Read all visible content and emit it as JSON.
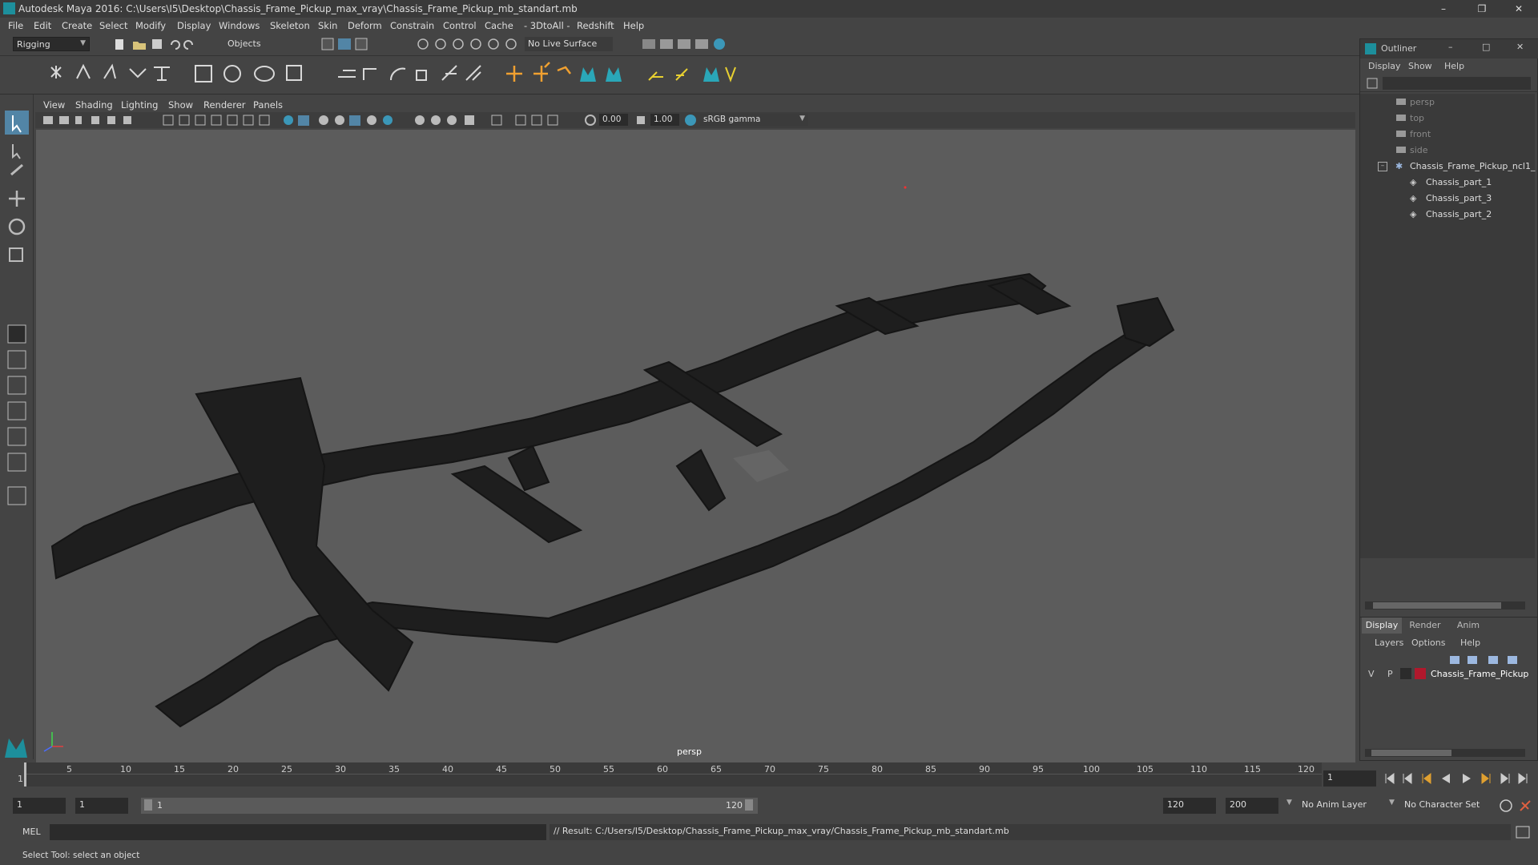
{
  "window": {
    "title": "Autodesk Maya 2016: C:\\Users\\I5\\Desktop\\Chassis_Frame_Pickup_max_vray\\Chassis_Frame_Pickup_mb_standart.mb"
  },
  "menubar": [
    "File",
    "Edit",
    "Create",
    "Select",
    "Modify",
    "Display",
    "Windows",
    "Skeleton",
    "Skin",
    "Deform",
    "Constrain",
    "Control",
    "Cache",
    "- 3DtoAll -",
    "Redshift",
    "Help"
  ],
  "shelf": {
    "mode": "Rigging",
    "object_mode": "Objects",
    "live_surface": "No Live Surface"
  },
  "viewport": {
    "menu": [
      "View",
      "Shading",
      "Lighting",
      "Show",
      "Renderer",
      "Panels"
    ],
    "near_value": "0.00",
    "far_value": "1.00",
    "color_space": "sRGB gamma",
    "camera_label": "persp"
  },
  "outliner": {
    "title": "Outliner",
    "menu": [
      "Display",
      "Show",
      "Help"
    ],
    "items": [
      {
        "label": "persp",
        "type": "camera",
        "indent": 0
      },
      {
        "label": "top",
        "type": "camera",
        "indent": 0
      },
      {
        "label": "front",
        "type": "camera",
        "indent": 0
      },
      {
        "label": "side",
        "type": "camera",
        "indent": 0
      },
      {
        "label": "Chassis_Frame_Pickup_ncl1_",
        "type": "group",
        "indent": 0
      },
      {
        "label": "Chassis_part_1",
        "type": "mesh",
        "indent": 1
      },
      {
        "label": "Chassis_part_3",
        "type": "mesh",
        "indent": 1
      },
      {
        "label": "Chassis_part_2",
        "type": "mesh",
        "indent": 1
      }
    ]
  },
  "layers": {
    "tabs": [
      "Display",
      "Render",
      "Anim"
    ],
    "menu": [
      "Layers",
      "Options",
      "Help"
    ],
    "layer": {
      "v": "V",
      "p": "P",
      "name": "Chassis_Frame_Pickup",
      "color": "#b0182c"
    }
  },
  "timeline": {
    "ticks": [
      "1",
      "5",
      "10",
      "15",
      "20",
      "25",
      "30",
      "35",
      "40",
      "45",
      "50",
      "55",
      "60",
      "65",
      "70",
      "75",
      "80",
      "85",
      "90",
      "95",
      "100",
      "105",
      "110",
      "115",
      "120"
    ],
    "current_frame": "1"
  },
  "range": {
    "start": "1",
    "start_inner": "1",
    "range_start": "1",
    "range_end": "120",
    "end_inner": "120",
    "end": "200",
    "anim_layer": "No Anim Layer",
    "char_set": "No Character Set"
  },
  "cmd": {
    "label": "MEL",
    "result": "// Result: C:/Users/I5/Desktop/Chassis_Frame_Pickup_max_vray/Chassis_Frame_Pickup_mb_standart.mb"
  },
  "help_line": "Select Tool: select an object",
  "colors": {
    "accent": "#5285a6",
    "layer": "#b0182c",
    "maya": "#1d8f9c"
  }
}
